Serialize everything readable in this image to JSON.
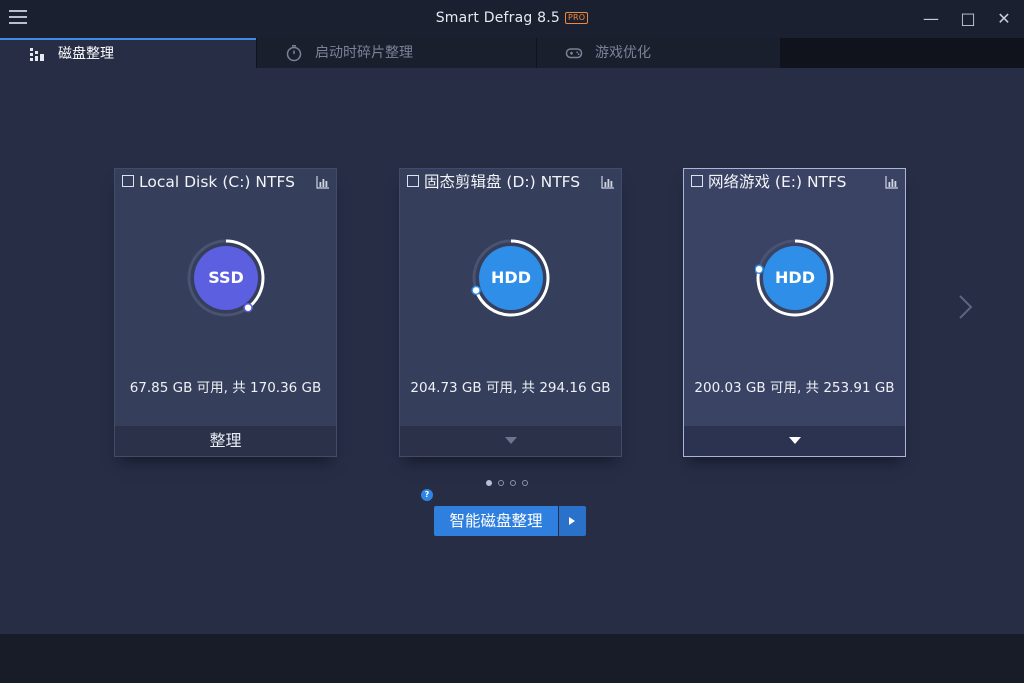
{
  "window": {
    "title": "Smart Defrag 8.5",
    "badge": "PRO",
    "minimize": "—",
    "maximize": "□",
    "close": "✕"
  },
  "tabs": [
    {
      "label": "磁盘整理",
      "icon": "disk-defrag-icon",
      "active": true
    },
    {
      "label": "启动时碎片整理",
      "icon": "boot-timer-icon",
      "active": false
    },
    {
      "label": "游戏优化",
      "icon": "gamepad-icon",
      "active": false
    }
  ],
  "disks": [
    {
      "name": "Local Disk (C:) NTFS",
      "type": "SSD",
      "space": "67.85 GB 可用, 共 170.36 GB",
      "action": "整理",
      "free_fraction": 0.3983,
      "color": "#5b5fe0",
      "selected": false
    },
    {
      "name": "固态剪辑盘 (D:) NTFS",
      "type": "HDD",
      "space": "204.73 GB 可用, 共 294.16 GB",
      "free_fraction": 0.696,
      "color": "#2f8ee8",
      "selected": false
    },
    {
      "name": "网络游戏 (E:) NTFS",
      "type": "HDD",
      "space": "200.03 GB 可用, 共 253.91 GB",
      "free_fraction": 0.7878,
      "color": "#2f8ee8",
      "selected": true
    }
  ],
  "pagination": {
    "pages": 4,
    "current": 0
  },
  "smart_defrag": {
    "label": "智能磁盘整理",
    "help": "?"
  },
  "colors": {
    "accent": "#2f7fde",
    "background": "#262d45",
    "card": "#353e5a"
  }
}
